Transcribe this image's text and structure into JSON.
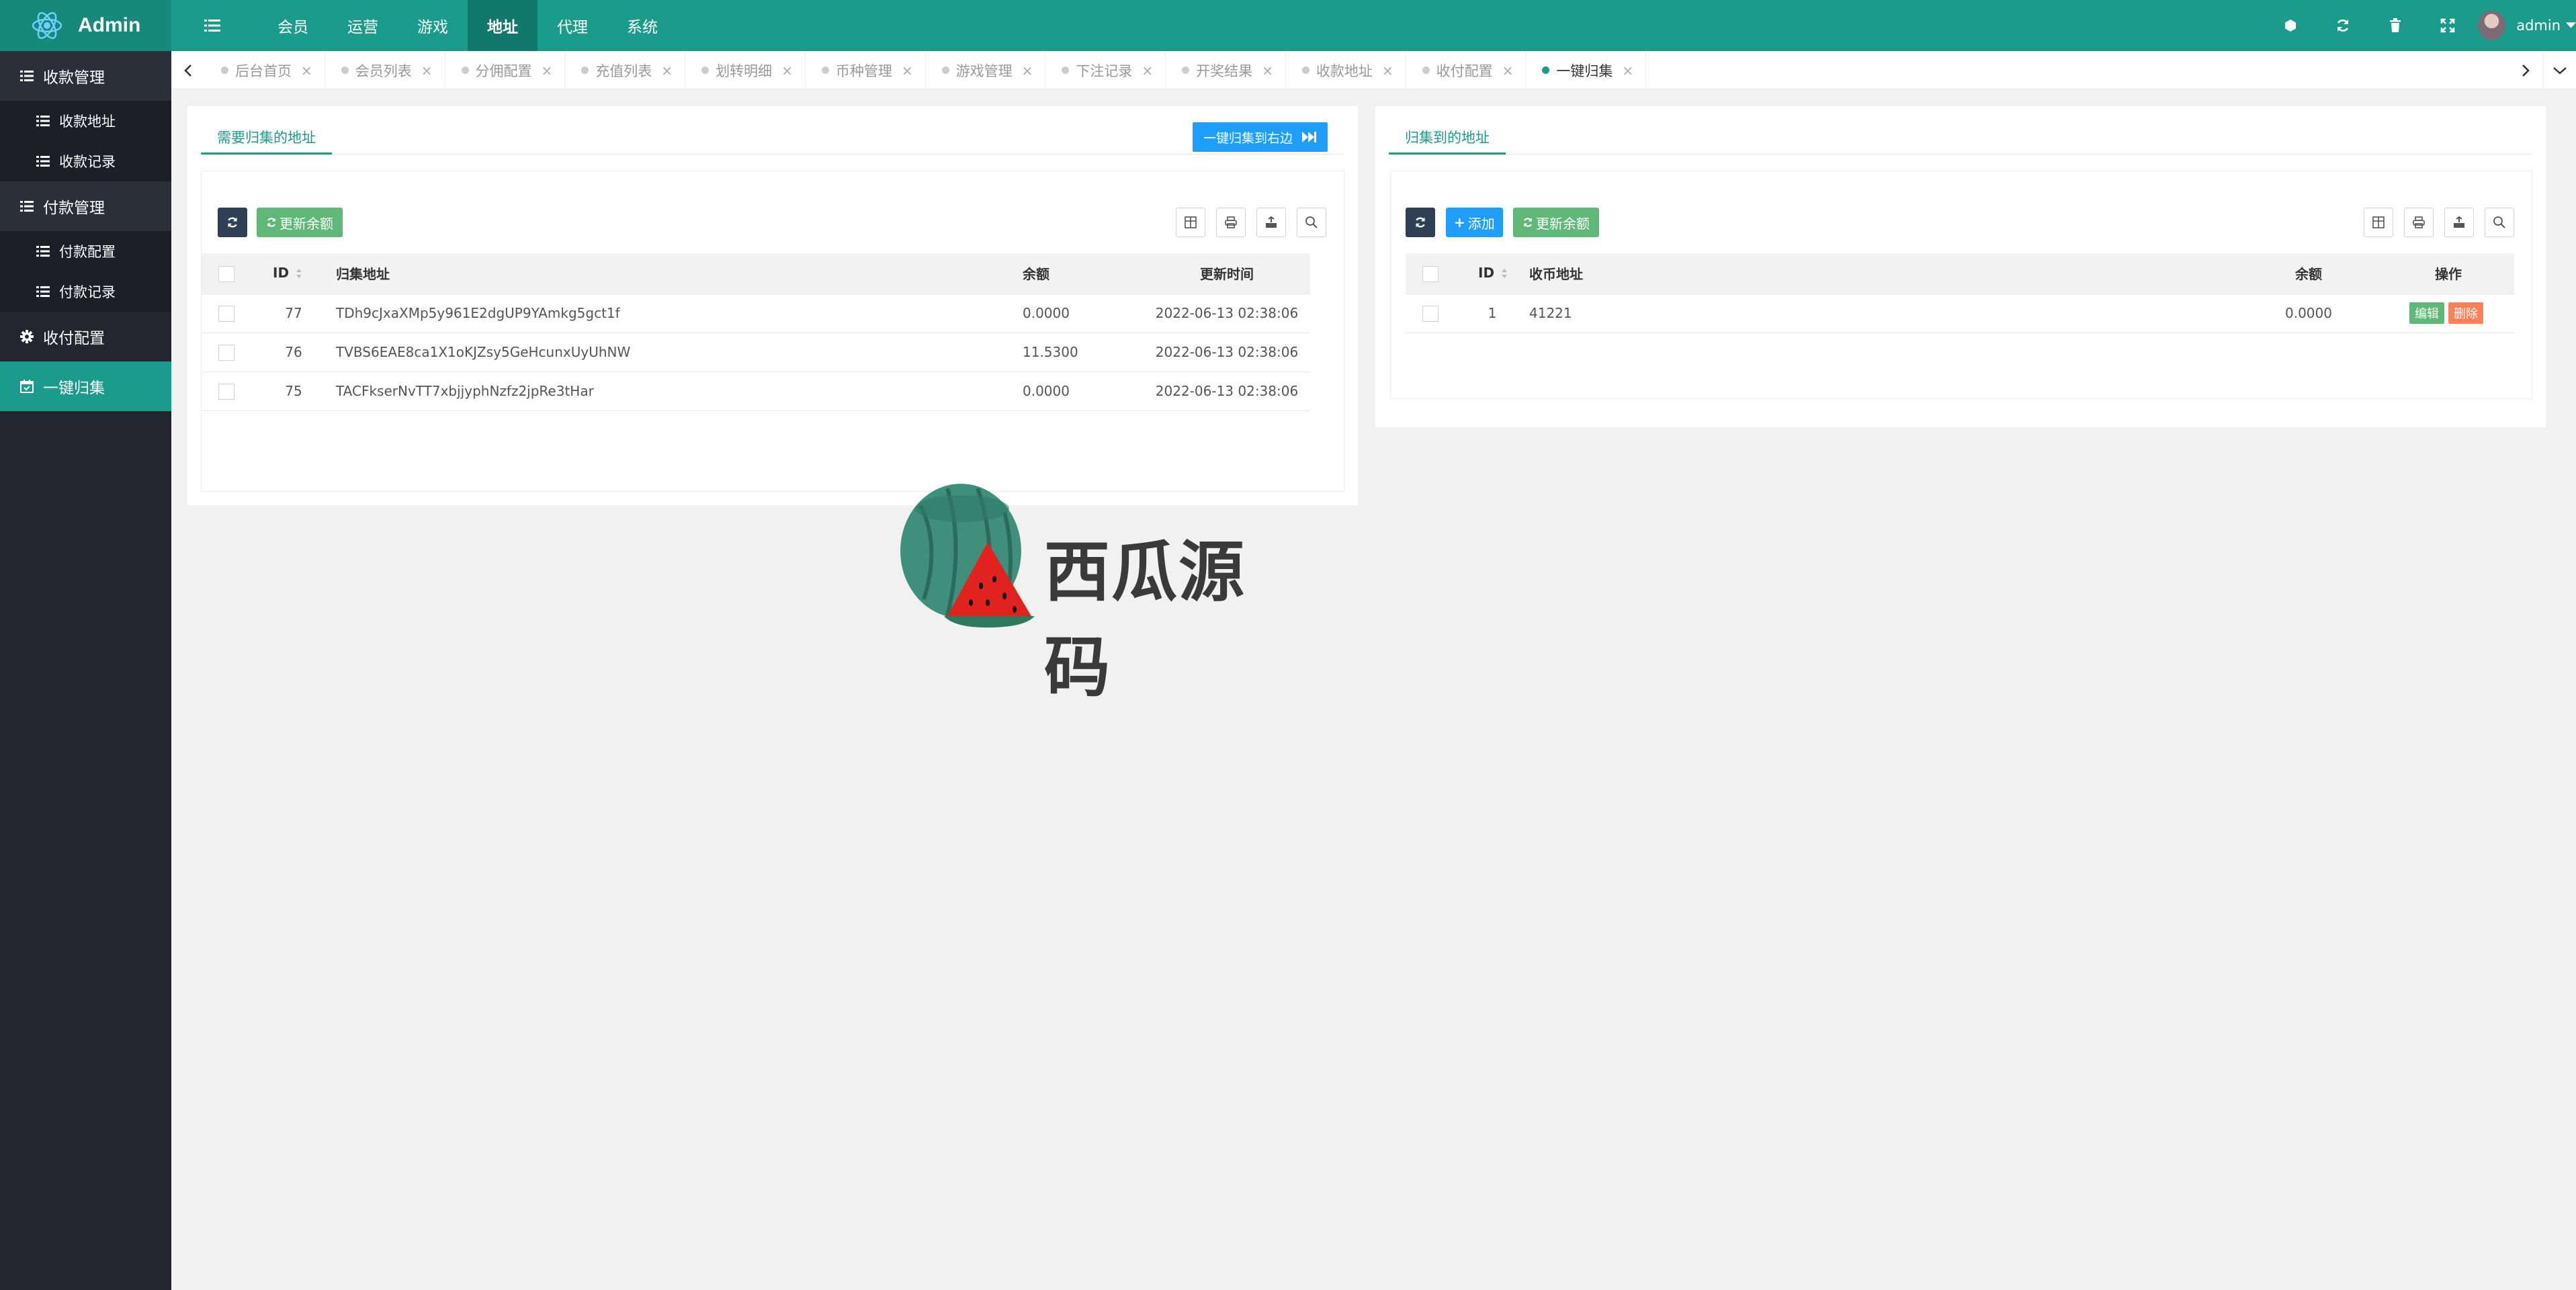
{
  "app": {
    "title": "Admin"
  },
  "top_nav": [
    {
      "label": "会员"
    },
    {
      "label": "运营"
    },
    {
      "label": "游戏"
    },
    {
      "label": "地址",
      "active": true
    },
    {
      "label": "代理"
    },
    {
      "label": "系统"
    }
  ],
  "user": {
    "name": "admin"
  },
  "sidebar": {
    "groups": [
      {
        "label": "收款管理",
        "icon": "list-icon",
        "children": [
          "收款地址",
          "收款记录"
        ]
      },
      {
        "label": "付款管理",
        "icon": "list-icon",
        "children": [
          "付款配置",
          "付款记录"
        ]
      },
      {
        "label": "收付配置",
        "icon": "gear-icon"
      },
      {
        "label": "一键归集",
        "icon": "calendar-icon",
        "active": true
      }
    ]
  },
  "tabs": [
    {
      "label": "后台首页"
    },
    {
      "label": "会员列表"
    },
    {
      "label": "分佣配置"
    },
    {
      "label": "充值列表"
    },
    {
      "label": "划转明细"
    },
    {
      "label": "币种管理"
    },
    {
      "label": "游戏管理"
    },
    {
      "label": "下注记录"
    },
    {
      "label": "开奖结果"
    },
    {
      "label": "收款地址"
    },
    {
      "label": "收付配置"
    },
    {
      "label": "一键归集",
      "active": true
    }
  ],
  "left_panel": {
    "tab_label": "需要归集的地址",
    "collect_button": "一键归集到右边",
    "refresh_balance": "更新余额",
    "columns": [
      "ID",
      "归集地址",
      "余额",
      "更新时间"
    ],
    "rows": [
      {
        "id": "77",
        "address": "TDh9cJxaXMp5y961E2dgUP9YAmkg5gct1f",
        "balance": "0.0000",
        "time": "2022-06-13 02:38:06"
      },
      {
        "id": "76",
        "address": "TVBS6EAE8ca1X1oKJZsy5GeHcunxUyUhNW",
        "balance": "11.5300",
        "time": "2022-06-13 02:38:06"
      },
      {
        "id": "75",
        "address": "TACFkserNvTT7xbjjyphNzfz2jpRe3tHar",
        "balance": "0.0000",
        "time": "2022-06-13 02:38:06"
      }
    ]
  },
  "right_panel": {
    "tab_label": "归集到的地址",
    "add_button": "添加",
    "refresh_balance": "更新余额",
    "columns": [
      "ID",
      "收币地址",
      "余额",
      "操作"
    ],
    "rows": [
      {
        "id": "1",
        "address": "41221",
        "balance": "0.0000",
        "edit": "编辑",
        "delete": "删除"
      }
    ]
  },
  "watermark": {
    "text": "西瓜源码"
  },
  "colors": {
    "primary": "#1a9b8c",
    "sidebar": "#23262e",
    "blue": "#1e9fff",
    "green": "#5fb878",
    "red": "#ff5722"
  }
}
